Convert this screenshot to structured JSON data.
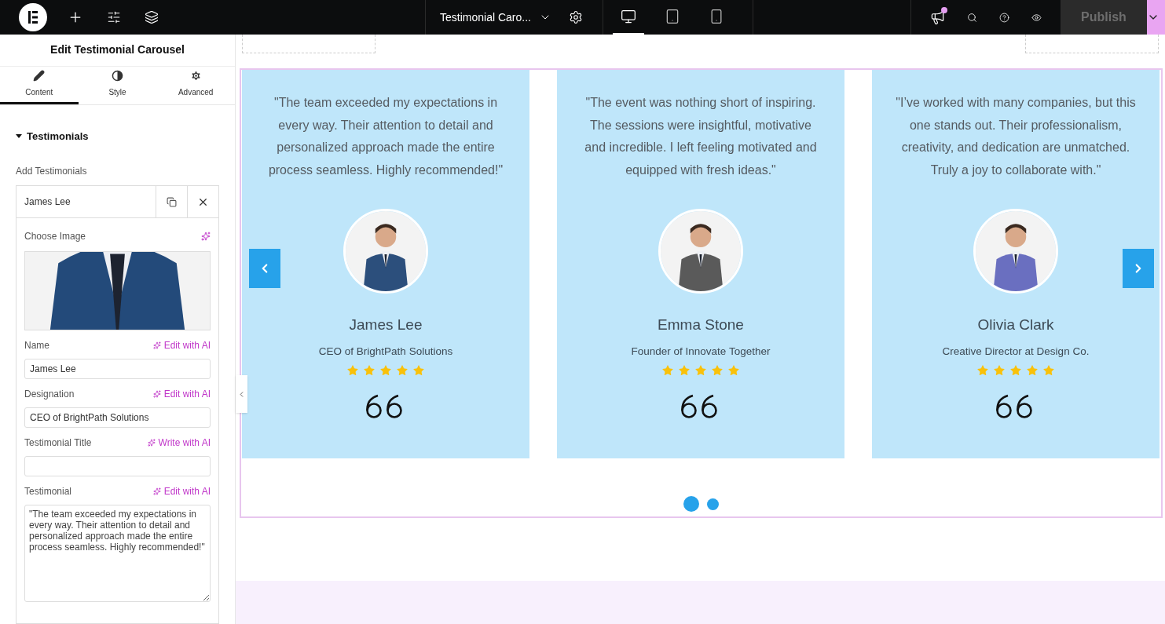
{
  "topbar": {
    "document_title": "Testimonial Caro...",
    "devices": [
      {
        "kind": "desktop",
        "selected": true
      },
      {
        "kind": "tablet",
        "selected": false
      },
      {
        "kind": "mobile",
        "selected": false
      }
    ],
    "publish": "Publish"
  },
  "panel": {
    "title": "Edit Testimonial Carousel",
    "tabs": [
      {
        "kind": "content",
        "label": "Content",
        "selected": true
      },
      {
        "kind": "style",
        "label": "Style",
        "selected": false
      },
      {
        "kind": "advanced",
        "label": "Advanced",
        "selected": false
      }
    ],
    "section": {
      "title": "Testimonials",
      "expanded": true
    },
    "repeater_label": "Add Testimonials",
    "item": {
      "title": "James Lee",
      "image_label": "Choose Image",
      "fields": [
        {
          "kind": "input",
          "label": "Name",
          "ai_action": "Edit with AI",
          "value": "James Lee"
        },
        {
          "kind": "input",
          "label": "Designation",
          "ai_action": "Edit with AI",
          "value": "CEO of BrightPath Solutions"
        },
        {
          "kind": "input",
          "label": "Testimonial Title",
          "ai_action": "Write with AI"
        },
        {
          "kind": "textarea",
          "label": "Testimonial",
          "ai_action": "Edit with AI",
          "value": "\"The team exceeded my expectations in every way. Their attention to detail and personalized approach made the entire process seamless. Highly recommended!\""
        }
      ]
    }
  },
  "carousel": {
    "slides": [
      {
        "quote": "\"The team exceeded my expectations in every way. Their attention to detail and personalized approach made the entire process seamless. Highly recommended!\"",
        "name": "James Lee",
        "designation": "CEO of BrightPath Solutions",
        "stars": 5
      },
      {
        "quote": "\"The event was nothing short of inspiring. The sessions were insightful, motivative and incredible. I left feeling motivated and equipped with fresh ideas.\"",
        "name": "Emma Stone",
        "designation": "Founder of Innovate Together",
        "stars": 5
      },
      {
        "quote": "\"I’ve worked with many companies, but this one stands out. Their professionalism, creativity, and dedication are unmatched. Truly a joy to collaborate with.\"",
        "name": "Olivia Clark",
        "designation": "Creative Director at Design Co.",
        "stars": 5
      }
    ],
    "dots": [
      {
        "selected": true
      },
      {
        "selected": false
      }
    ]
  }
}
